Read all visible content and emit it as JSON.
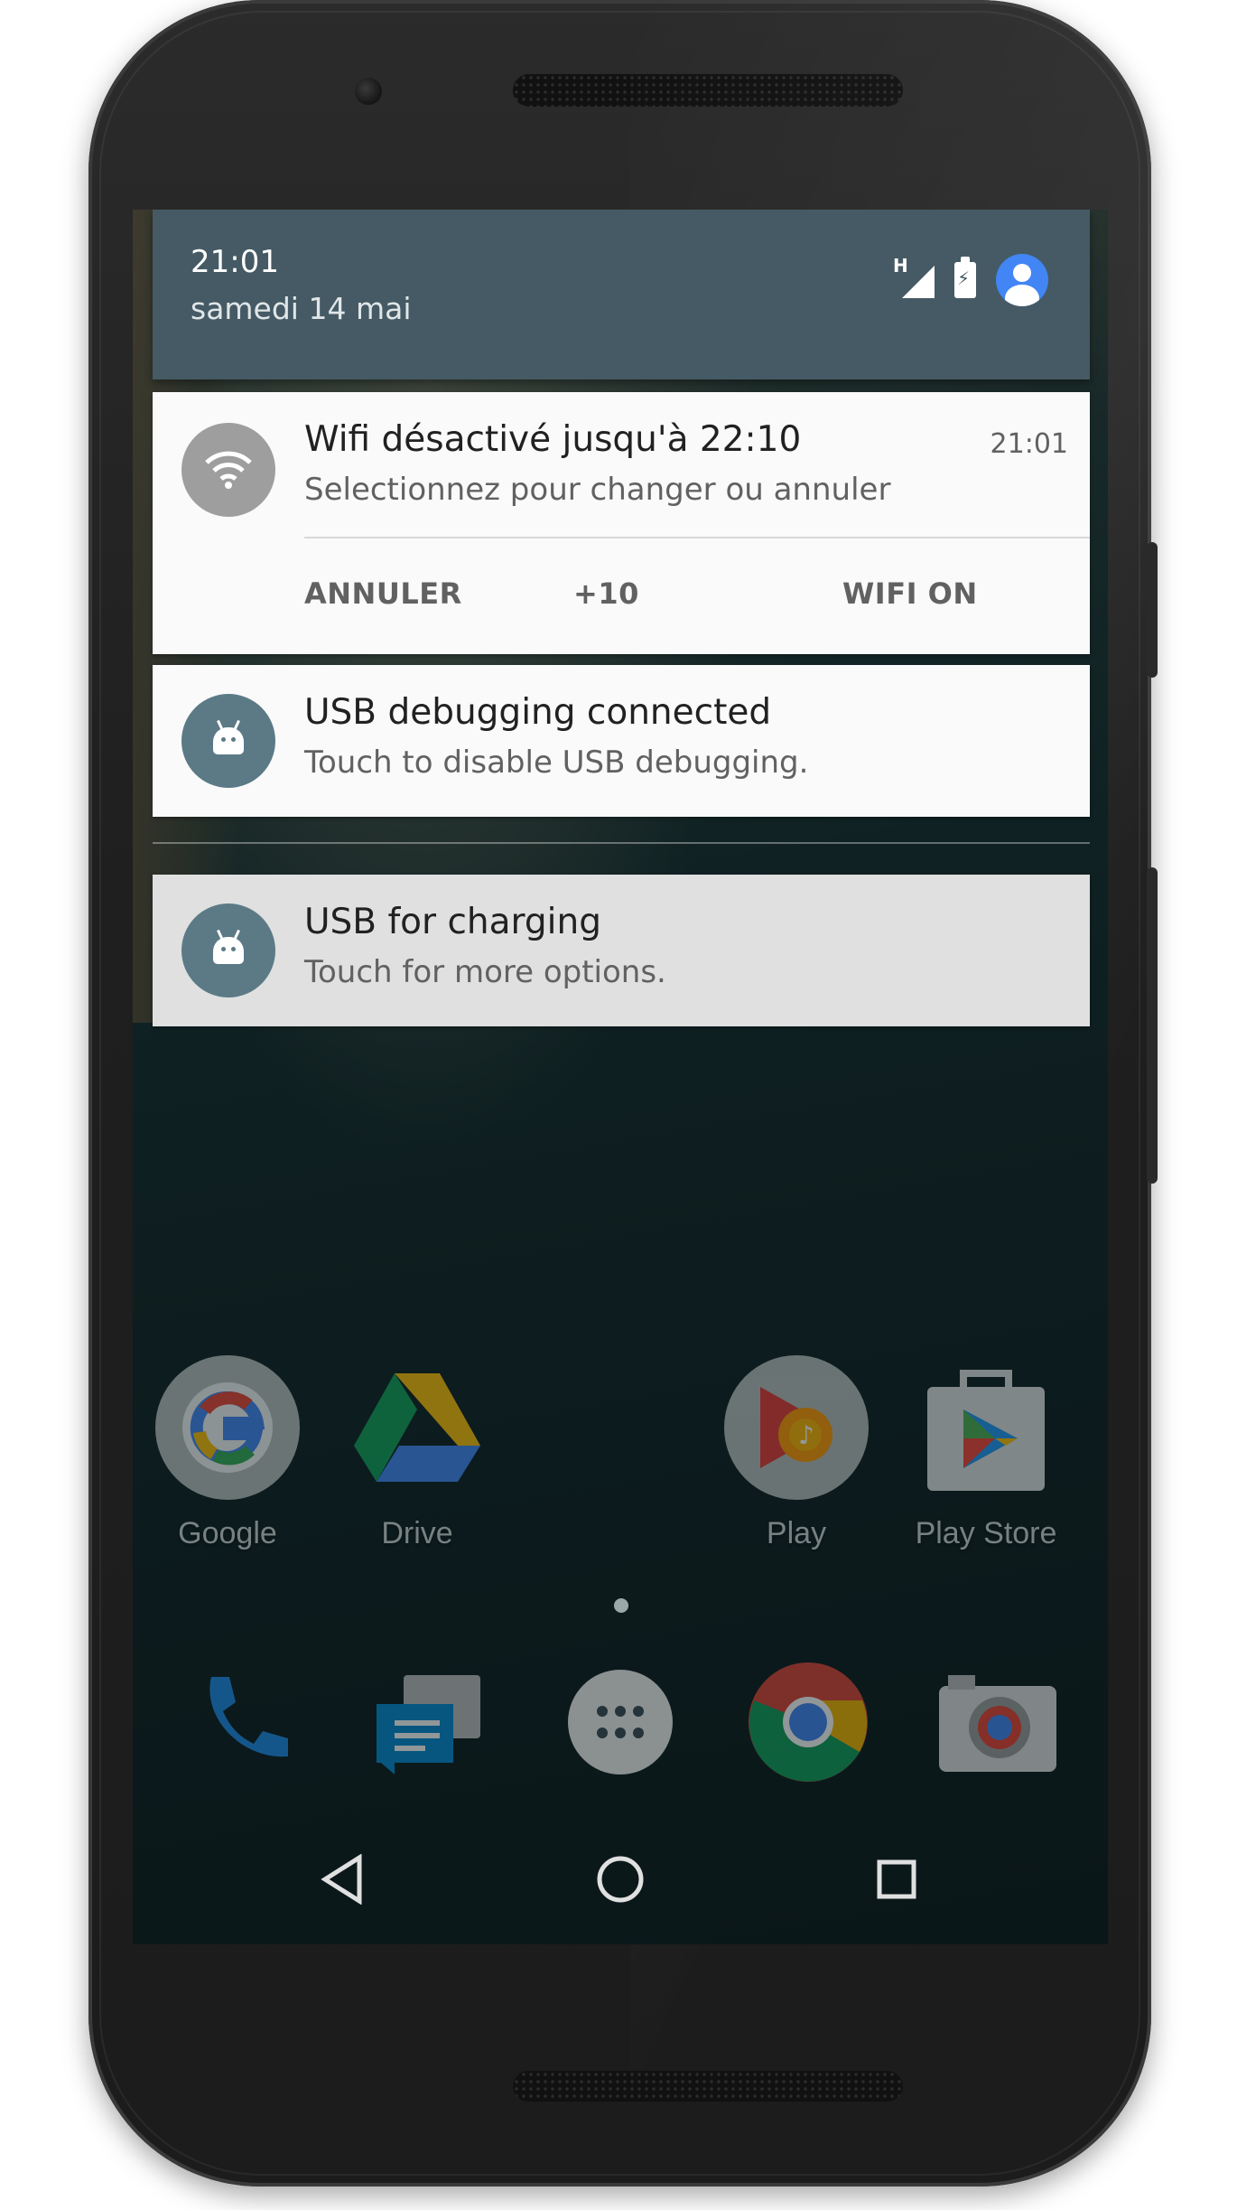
{
  "status_bar": {
    "time": "21:01",
    "date": "samedi 14 mai",
    "network_label": "H",
    "icons": [
      "signal-icon",
      "battery-charging-icon",
      "user-avatar-icon"
    ]
  },
  "notifications": [
    {
      "icon": "wifi-icon",
      "title": "Wifi désactivé jusqu'à 22:10",
      "text": "Selectionnez pour changer ou annuler",
      "time": "21:01",
      "actions": [
        "ANNULER",
        "+10",
        "WIFI ON"
      ]
    },
    {
      "icon": "android-icon",
      "title": "USB debugging connected",
      "text": "Touch to disable USB debugging."
    },
    {
      "icon": "android-icon",
      "title": "USB for charging",
      "text": "Touch for more options."
    }
  ],
  "home_apps": [
    {
      "label": "Google",
      "icon": "google-folder-icon"
    },
    {
      "label": "Drive",
      "icon": "drive-icon"
    },
    {
      "label": "Play",
      "icon": "play-folder-icon"
    },
    {
      "label": "Play Store",
      "icon": "play-store-icon"
    }
  ],
  "dock": [
    "phone-icon",
    "messenger-icon",
    "app-drawer-icon",
    "chrome-icon",
    "camera-icon"
  ],
  "nav": [
    "back-icon",
    "home-icon",
    "recents-icon"
  ],
  "colors": {
    "shade_header": "#455a64",
    "notification_bg": "#fafafa",
    "accent_blue": "#4285f4"
  }
}
